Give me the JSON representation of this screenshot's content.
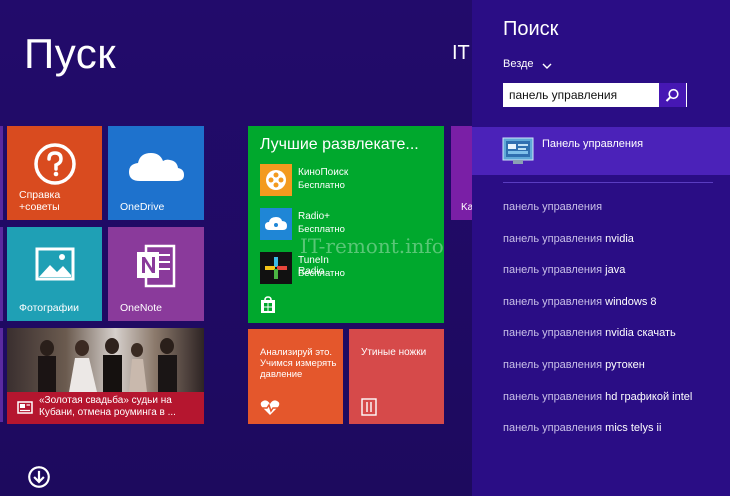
{
  "start": {
    "title": "Пуск",
    "user_label_cut": "IT"
  },
  "tiles": {
    "help_label": "Справка\n+советы",
    "onedrive_label": "OneDrive",
    "photos_label": "Фотографии",
    "onenote_label": "OneNote",
    "news_text": "«Золотая свадьба» судьи на Кубани, отмена роуминга в ...",
    "health_text": "Анализируй это. Учимся измерять давление",
    "food_text": "Утиные ножки",
    "entertainment": {
      "title": "Лучшие развлекате...",
      "apps": [
        {
          "name": "КиноПоиск",
          "price": "Бесплатно"
        },
        {
          "name": "Radio+",
          "price": "Бесплатно"
        },
        {
          "name": "TuneIn Radio",
          "price": "Бесплатно"
        }
      ]
    },
    "cut_tile_label": "Ka"
  },
  "watermark": "IT-remont.info",
  "search": {
    "title": "Поиск",
    "scope": "Везде",
    "query": "панель управления",
    "top_result": "Панель управления",
    "suggestion_prefix": "панель управления",
    "suggestions": [
      {
        "rest": ""
      },
      {
        "rest": " nvidia"
      },
      {
        "rest": " java"
      },
      {
        "rest": " windows 8"
      },
      {
        "rest": " nvidia скачать"
      },
      {
        "rest": " рутокен"
      },
      {
        "rest": " hd графикой intel"
      },
      {
        "rest": " mics telys ii"
      }
    ]
  },
  "colors": {
    "start_bg": "#220b6b",
    "search_panel": "#2a0d85",
    "selected_result": "#4b22b9",
    "help_tile": "#d94b1f",
    "onedrive_tile": "#1e72cd",
    "photos_tile": "#1fa0b5",
    "onenote_tile": "#8a3a9b",
    "entertainment_tile": "#00a82d",
    "health_tile": "#e4572c",
    "news_caption": "#b5162f"
  }
}
